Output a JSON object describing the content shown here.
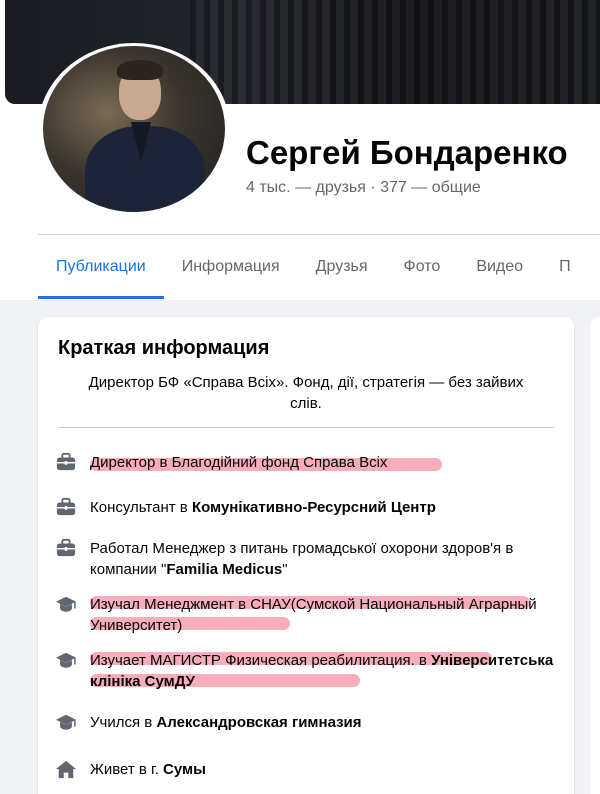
{
  "profile": {
    "name": "Сергей Бондаренко",
    "friends_count": "4 тыс. — друзья",
    "separator": "·",
    "mutual_count": "377 — общие"
  },
  "tabs": [
    {
      "label": "Публикации",
      "active": true
    },
    {
      "label": "Информация",
      "active": false
    },
    {
      "label": "Друзья",
      "active": false
    },
    {
      "label": "Фото",
      "active": false
    },
    {
      "label": "Видео",
      "active": false
    },
    {
      "label": "П",
      "active": false
    }
  ],
  "intro": {
    "title": "Краткая информация",
    "bio": "Директор БФ «Справа Всіх». Фонд, дії, стратегія — без зайвих слів.",
    "items": [
      {
        "icon": "briefcase-icon",
        "prefix": "Директор в Благодійний фонд Справа Всіх",
        "bold": "",
        "suffix": "",
        "highlighted": true
      },
      {
        "icon": "briefcase-icon",
        "prefix": "Консультант в ",
        "bold": "Комунікативно-Ресурсний Центр",
        "suffix": "",
        "highlighted": false
      },
      {
        "icon": "briefcase-icon",
        "prefix": "Работал Менеджер з питань громадської охорони здоров'я в компании \"",
        "bold": "Familia Medicus",
        "suffix": "\"",
        "highlighted": false
      },
      {
        "icon": "graduation-cap-icon",
        "prefix": "Изучал Менеджмент в СНАУ(Сумской Национальный Аграрный Университет)",
        "bold": "",
        "suffix": "",
        "highlighted": true
      },
      {
        "icon": "graduation-cap-icon",
        "prefix": "Изучает МАГИСТР Физическая реабилитация. в ",
        "bold": "Університетська клініка СумДУ",
        "suffix": "",
        "highlighted": true
      },
      {
        "icon": "graduation-cap-icon",
        "prefix": "Учился в ",
        "bold": "Александровская гимназия",
        "suffix": "",
        "highlighted": false
      },
      {
        "icon": "home-icon",
        "prefix": "Живет в г. ",
        "bold": "Сумы",
        "suffix": "",
        "highlighted": false
      }
    ]
  },
  "colors": {
    "accent": "#1b74e4",
    "highlight": "#eb3c5a",
    "muted_text": "#65676b",
    "icon": "#606770"
  }
}
